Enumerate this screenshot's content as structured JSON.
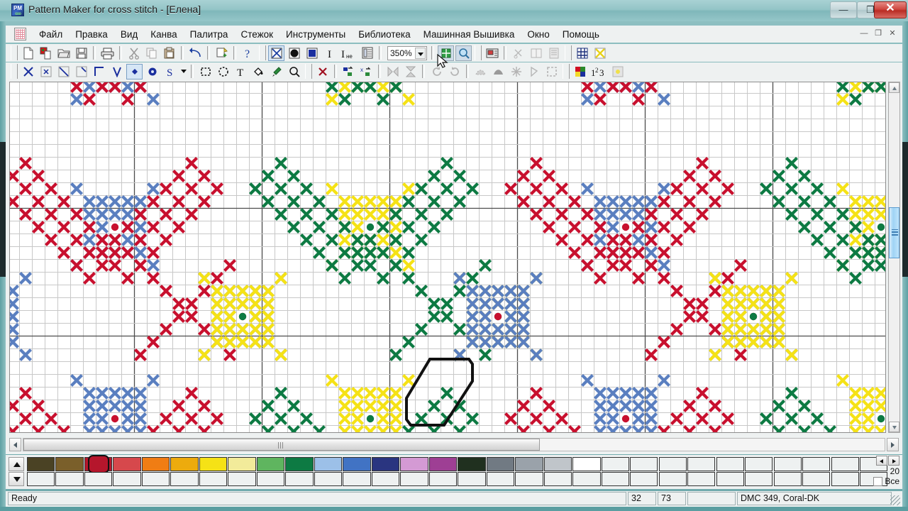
{
  "window": {
    "title": "Pattern Maker for cross stitch - [Елена]",
    "app_icon": "pattern-maker-icon",
    "minimize_label": "—",
    "maximize_label": "❐",
    "close_label": "✕"
  },
  "menubar": {
    "doc_icon": "document-pattern-icon",
    "items": [
      {
        "label": "Файл",
        "name": "menu-file"
      },
      {
        "label": "Правка",
        "name": "menu-edit"
      },
      {
        "label": "Вид",
        "name": "menu-view"
      },
      {
        "label": "Канва",
        "name": "menu-canvas"
      },
      {
        "label": "Палитра",
        "name": "menu-palette"
      },
      {
        "label": "Стежок",
        "name": "menu-stitch"
      },
      {
        "label": "Инструменты",
        "name": "menu-tools"
      },
      {
        "label": "Библиотека",
        "name": "menu-library"
      },
      {
        "label": "Машинная Вышивка",
        "name": "menu-machine-embroidery"
      },
      {
        "label": "Окно",
        "name": "menu-window"
      },
      {
        "label": "Помощь",
        "name": "menu-help"
      }
    ],
    "doc_minimize": "—",
    "doc_restore": "❐",
    "doc_close": "✕"
  },
  "toolbar_main": {
    "buttons": [
      {
        "name": "new-document-icon",
        "title": "New"
      },
      {
        "name": "new-from-image-icon",
        "title": "New from image"
      },
      {
        "name": "open-folder-icon",
        "title": "Open"
      },
      {
        "name": "save-disk-icon",
        "title": "Save"
      },
      {
        "name": "print-icon",
        "title": "Print"
      },
      {
        "name": "cut-scissors-icon",
        "title": "Cut"
      },
      {
        "name": "copy-icon",
        "title": "Copy"
      },
      {
        "name": "paste-clipboard-icon",
        "title": "Paste"
      },
      {
        "name": "undo-arrow-icon",
        "title": "Undo"
      },
      {
        "name": "magic-wand-icon",
        "title": "Magic"
      },
      {
        "name": "help-question-icon",
        "title": "Help"
      },
      {
        "name": "view-stitches-icon",
        "title": "Stitch view"
      },
      {
        "name": "view-symbols-icon",
        "title": "Symbol view"
      },
      {
        "name": "view-solid-icon",
        "title": "Solid view"
      },
      {
        "name": "text-info-icon",
        "title": "Information"
      },
      {
        "name": "text-metric-icon",
        "title": "Metric text"
      },
      {
        "name": "properties-list-icon",
        "title": "Properties"
      },
      {
        "name": "zoom-fit-icon",
        "title": "Fit to window"
      },
      {
        "name": "zoom-tool-icon",
        "title": "Zoom"
      },
      {
        "name": "pattern-window-icon",
        "title": "Pattern window"
      },
      {
        "name": "scissors-small-icon",
        "title": "Trim"
      },
      {
        "name": "split-view-icon",
        "title": "Split"
      },
      {
        "name": "page-list-icon",
        "title": "Pages"
      },
      {
        "name": "grid-toggle-icon",
        "title": "Grid"
      },
      {
        "name": "grid-cross-icon",
        "title": "Grid cross"
      }
    ],
    "zoom": {
      "value": "350%",
      "name": "zoom-combo"
    }
  },
  "toolbar_stitch": {
    "buttons": [
      {
        "name": "full-cross-stitch-icon"
      },
      {
        "name": "mini-cross-stitch-icon"
      },
      {
        "name": "half-stitch-icon"
      },
      {
        "name": "quarter-stitch-icon"
      },
      {
        "name": "back-stitch-icon"
      },
      {
        "name": "straight-stitch-icon"
      },
      {
        "name": "french-knot-small-icon"
      },
      {
        "name": "french-knot-large-icon"
      },
      {
        "name": "special-stitch-s-icon"
      },
      {
        "name": "stitch-dropdown-icon"
      },
      {
        "name": "rect-select-icon"
      },
      {
        "name": "lasso-select-icon"
      },
      {
        "name": "text-tool-icon"
      },
      {
        "name": "fill-bucket-icon"
      },
      {
        "name": "eyedropper-icon"
      },
      {
        "name": "magnifier-icon"
      },
      {
        "name": "delete-x-icon"
      },
      {
        "name": "color-replace-icon"
      },
      {
        "name": "symbol-replace-icon"
      },
      {
        "name": "flip-horizontal-icon"
      },
      {
        "name": "flip-vertical-icon"
      },
      {
        "name": "rotate-cw-icon"
      },
      {
        "name": "rotate-ccw-icon"
      },
      {
        "name": "stretch-icon"
      },
      {
        "name": "distort-icon"
      },
      {
        "name": "snowflake-icon"
      },
      {
        "name": "corner-icon"
      },
      {
        "name": "marquee-dashed-icon"
      },
      {
        "name": "color-blocks-icon"
      },
      {
        "name": "numbering-123-icon"
      },
      {
        "name": "texture-icon"
      }
    ]
  },
  "chart": {
    "background": "#ffffff",
    "grid_color": "#c8c8c8",
    "grid_major_color": "#4d4d4d",
    "cell_size": 18,
    "major_every": 10,
    "selection": {
      "name": "selection-outline",
      "color": "#111111"
    },
    "palette_colors": {
      "red": "#c8102e",
      "blue": "#5a7fc0",
      "green": "#0d7a43",
      "yellow": "#f5e216",
      "black": "#1a1a1a"
    },
    "stitch_layout_note": "Repeating cross-stitch medallion motif: red and blue in left block, green and yellow in centre block, red and blue again at right."
  },
  "scrollbars": {
    "vertical": {
      "name": "vertical-scrollbar",
      "up": "▲",
      "down": "▼",
      "thumb_position_pct": 36
    },
    "horizontal": {
      "name": "horizontal-scrollbar",
      "left": "◀",
      "right": "▶",
      "thumb_position_pct": 0
    }
  },
  "palette": {
    "scroll_up": "▲",
    "scroll_down": "▼",
    "count": "20",
    "all_label": "Все",
    "all_checked": false,
    "nav_left": "←",
    "nav_right": "→",
    "selected_index": 2,
    "row1": [
      "#4a4224",
      "#7a5f2a",
      "#b5162c",
      "#d6484c",
      "#f07d14",
      "#edab0d",
      "#f5e216",
      "#f2eb9a",
      "#5fb55f",
      "#0d7a43",
      "#9cc0e8",
      "#4173c4",
      "#2a3580",
      "#d49ad4",
      "#9e3f94",
      "#20301f",
      "#717a83",
      "#9aa2aa",
      "#c0c5ca",
      "#ffffff",
      "#eef1f1",
      "#eef1f1",
      "#eef1f1",
      "#eef1f1",
      "#eef1f1",
      "#eef1f1",
      "#eef1f1",
      "#eef1f1",
      "#eef1f1",
      "#eef1f1"
    ],
    "row2": [
      "#eef1f1",
      "#eef1f1",
      "#eef1f1",
      "#eef1f1",
      "#eef1f1",
      "#eef1f1",
      "#eef1f1",
      "#eef1f1",
      "#eef1f1",
      "#eef1f1",
      "#eef1f1",
      "#eef1f1",
      "#eef1f1",
      "#eef1f1",
      "#eef1f1",
      "#eef1f1",
      "#eef1f1",
      "#eef1f1",
      "#eef1f1",
      "#eef1f1",
      "#eef1f1",
      "#eef1f1",
      "#eef1f1",
      "#eef1f1",
      "#eef1f1",
      "#eef1f1",
      "#eef1f1",
      "#eef1f1",
      "#eef1f1",
      "#eef1f1"
    ]
  },
  "statusbar": {
    "message": "Ready",
    "cursor_x": "32",
    "cursor_y": "73",
    "extra": "",
    "thread": "DMC  349, Coral-DK"
  }
}
